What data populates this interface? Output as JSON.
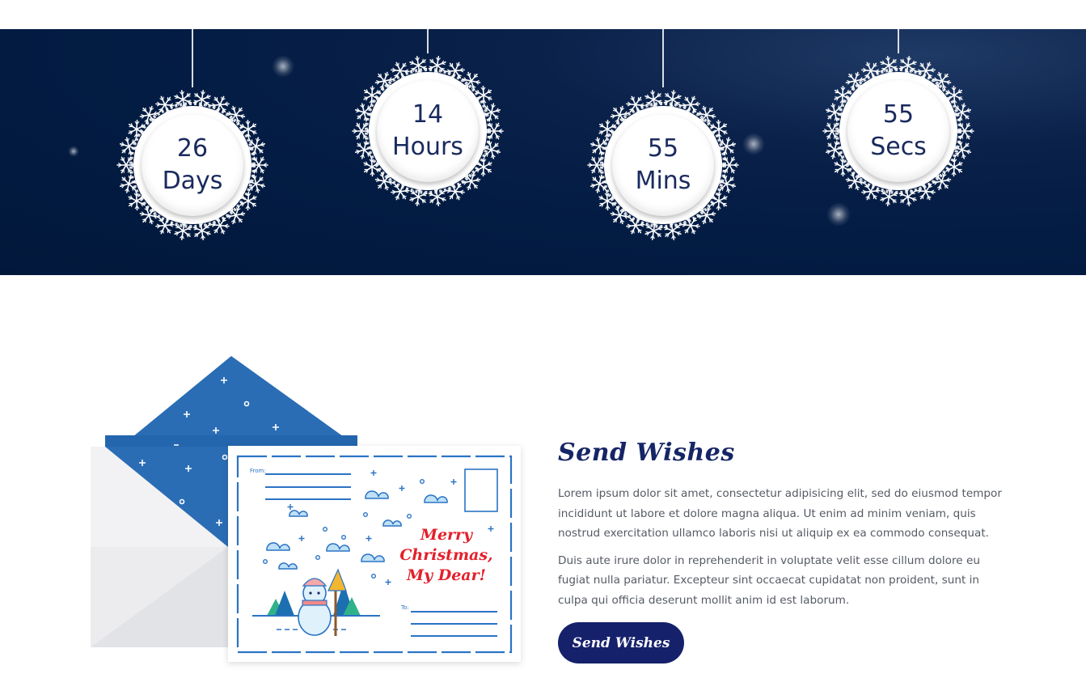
{
  "countdown": {
    "items": [
      {
        "value": "26",
        "unit": "Days"
      },
      {
        "value": "14",
        "unit": "Hours"
      },
      {
        "value": "55",
        "unit": "Mins"
      },
      {
        "value": "55",
        "unit": "Secs"
      }
    ]
  },
  "postcard": {
    "from_label": "From:",
    "to_label": "To:",
    "greeting_line1": "Merry",
    "greeting_line2": "Christmas,",
    "greeting_line3": "My Dear!"
  },
  "wishes": {
    "title": "Send Wishes",
    "paragraph1": "Lorem ipsum dolor sit amet, consectetur adipisicing elit, sed do eiusmod tempor incididunt ut labore et dolore magna aliqua. Ut enim ad minim veniam, quis nostrud exercitation ullamco laboris nisi ut aliquip ex ea commodo consequat.",
    "paragraph2": "Duis aute irure dolor in reprehenderit in voluptate velit esse cillum dolore eu fugiat nulla pariatur. Excepteur sint occaecat cupidatat non proident, sunt in culpa qui officia deserunt mollit anim id est laborum.",
    "button_label": "Send Wishes"
  },
  "colors": {
    "banner_bg": "#031c43",
    "accent_navy": "#15216b",
    "envelope_blue": "#2a6db5",
    "greeting_red": "#e3202b"
  }
}
